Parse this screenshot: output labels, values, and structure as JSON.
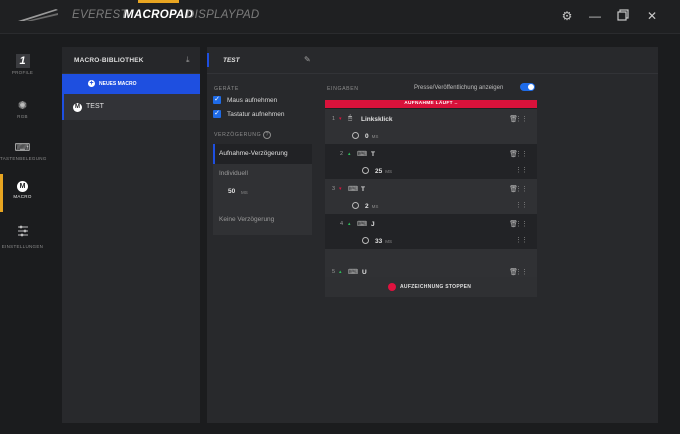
{
  "titlebar": {
    "tabs": [
      "EVEREST",
      "MACROPAD",
      "DISPLAYPAD"
    ],
    "active_tab": "MACROPAD"
  },
  "rail": {
    "items": [
      {
        "label": "PROFILE",
        "icon": "profile-number-icon",
        "value": "1"
      },
      {
        "label": "RGB",
        "icon": "light-bulb-icon"
      },
      {
        "label": "TASTENBELEGUNG",
        "icon": "keyboard-icon"
      },
      {
        "label": "MACRO",
        "icon": "macro-m-icon"
      },
      {
        "label": "EINSTELLUNGEN",
        "icon": "sliders-icon"
      }
    ]
  },
  "library": {
    "title": "MACRO-BIBLIOTHEK",
    "new_macro_label": "NEUES MACRO",
    "macros": [
      {
        "badge": "M",
        "name": "TEST"
      }
    ]
  },
  "editor": {
    "title": "TEST",
    "devices_heading": "GERÄTE",
    "record_mouse": "Maus aufnehmen",
    "record_keyboard": "Tastatur aufnehmen",
    "delay_heading": "VERZÖGERUNG",
    "delay_options": {
      "selected": "Aufnahme-Verzögerung",
      "custom_label": "Individuell",
      "custom_value": "50",
      "custom_unit": "MS",
      "none": "Keine Verzögerung"
    },
    "inputs_heading": "EINGABEN",
    "show_press_release": "Presse/Veröffentlichung anzeigen",
    "recording_banner": "AUFNAHME LÄUFT ..",
    "stop_label": "AUFZEICHNUNG STOPPEN",
    "events": [
      {
        "num": "1",
        "direction": "down",
        "icon": "mouse-icon",
        "name": "Linksklick",
        "delay": "0",
        "unit": "MS"
      },
      {
        "num": "2",
        "direction": "up",
        "icon": "keyboard-icon",
        "name": "T",
        "delay": "25",
        "unit": "MS"
      },
      {
        "num": "3",
        "direction": "down",
        "icon": "keyboard-icon",
        "name": "T",
        "delay": "2",
        "unit": "MS"
      },
      {
        "num": "4",
        "direction": "up",
        "icon": "keyboard-icon",
        "name": "J",
        "delay": "33",
        "unit": "MS"
      },
      {
        "num": "5",
        "direction": "up",
        "icon": "keyboard-icon",
        "name": "U"
      }
    ]
  },
  "colors": {
    "accent_blue": "#1e4fe0",
    "accent_orange": "#e8a521",
    "recording_red": "#d9123b",
    "arrow_down": "#e0123f",
    "arrow_up": "#2bbf5a"
  }
}
